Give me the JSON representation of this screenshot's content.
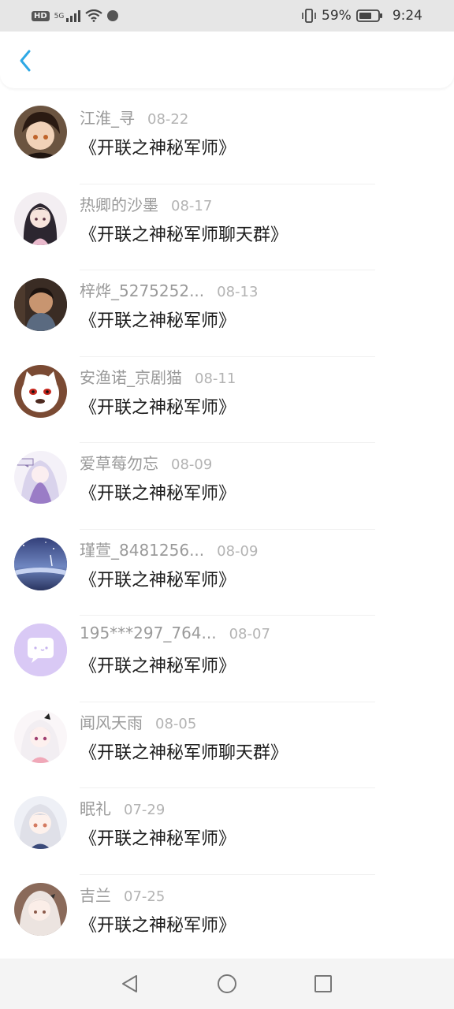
{
  "status_bar": {
    "hd": "HD",
    "network": "5G",
    "battery": "59%",
    "time": "9:24"
  },
  "header": {
    "back_icon": "chevron-left-icon",
    "accent": "#2ea8e5"
  },
  "items": [
    {
      "name": "江淮_寻",
      "date": "08-22",
      "message": "《开联之神秘军师》",
      "avatar": "anime-boy"
    },
    {
      "name": "热卿的沙墨",
      "date": "08-17",
      "message": "《开联之神秘军师聊天群》",
      "avatar": "anime-girl-dark"
    },
    {
      "name": "梓烨_5275252...",
      "date": "08-13",
      "message": "《开联之神秘军师》",
      "avatar": "child-photo"
    },
    {
      "name": "安渔诺_京剧猫",
      "date": "08-11",
      "message": "《开联之神秘军师》",
      "avatar": "cat-mascot"
    },
    {
      "name": "爱草莓勿忘",
      "date": "08-09",
      "message": "《开联之神秘军师》",
      "avatar": "anime-girl-purple"
    },
    {
      "name": "瑾萱_8481256...",
      "date": "08-09",
      "message": "《开联之神秘军师》",
      "avatar": "night-sky"
    },
    {
      "name": "195***297_764...",
      "date": "08-07",
      "message": "《开联之神秘军师》",
      "avatar": "default-chat"
    },
    {
      "name": "闻风天雨",
      "date": "08-05",
      "message": "《开联之神秘军师聊天群》",
      "avatar": "anime-girl-white"
    },
    {
      "name": "眠礼",
      "date": "07-29",
      "message": "《开联之神秘军师》",
      "avatar": "anime-girl-silver"
    },
    {
      "name": "吉兰",
      "date": "07-25",
      "message": "《开联之神秘军师》",
      "avatar": "anime-girl-pale"
    }
  ],
  "nav": {
    "back": "triangle-back-icon",
    "home": "circle-home-icon",
    "recent": "square-recent-icon"
  }
}
